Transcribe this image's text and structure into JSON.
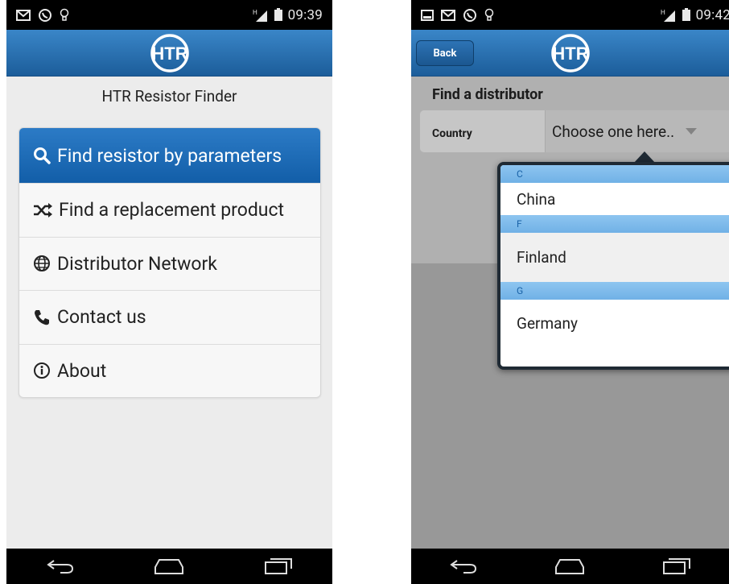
{
  "left_screen": {
    "status": {
      "time": "09:39",
      "network": "H"
    },
    "title": "HTR Resistor Finder",
    "logo_text": "HTR",
    "menu": [
      {
        "label": "Find resistor by parameters",
        "icon": "search-icon",
        "active": true
      },
      {
        "label": "Find a replacement product",
        "icon": "shuffle-icon",
        "active": false
      },
      {
        "label": "Distributor Network",
        "icon": "globe-icon",
        "active": false
      },
      {
        "label": "Contact us",
        "icon": "phone-icon",
        "active": false
      },
      {
        "label": "About",
        "icon": "info-icon",
        "active": false
      }
    ]
  },
  "right_screen": {
    "status": {
      "time": "09:42",
      "network": "H"
    },
    "back_label": "Back",
    "logo_text": "HTR",
    "section_title": "Find a distributor",
    "field_label": "Country",
    "select_value": "Choose one here..",
    "dropdown": [
      {
        "divider": "C",
        "option": "China"
      },
      {
        "divider": "F",
        "option": "Finland"
      },
      {
        "divider": "G",
        "option": "Germany"
      }
    ]
  },
  "colors": {
    "header_blue": "#1c5d9a",
    "active_blue": "#2c7bc6",
    "divider_blue": "#8ec5f0"
  }
}
